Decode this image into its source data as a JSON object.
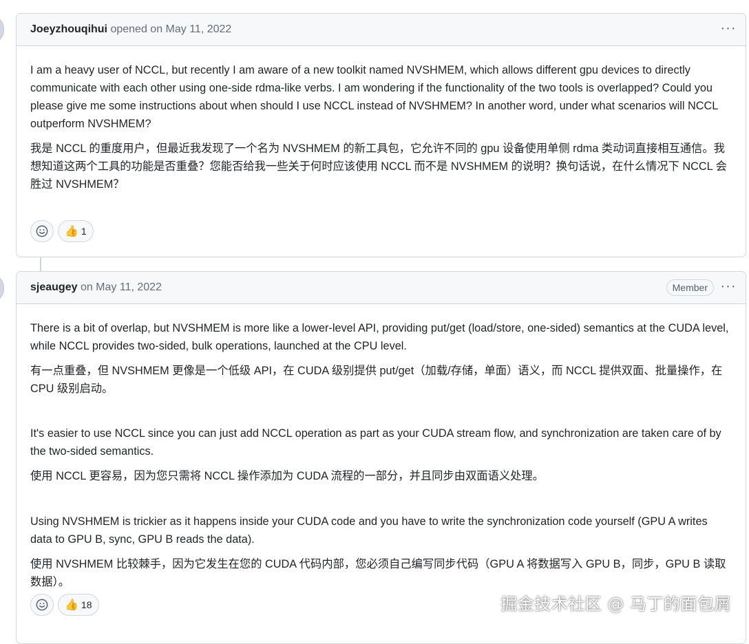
{
  "comments": [
    {
      "author": "Joeyzhouqihui",
      "meta": "opened on May 11, 2022",
      "menu_glyph": "···",
      "paragraphs": [
        "I am a heavy user of NCCL, but recently I am aware of a new toolkit named NVSHMEM, which allows different gpu devices to directly communicate with each other using one-side rdma-like verbs. I am wondering if the functionality of the two tools is overlapped? Could you please give me some instructions about when should I use NCCL instead of NVSHMEM? In another word, under what scenarios will NCCL outperform NVSHMEM?",
        "我是 NCCL 的重度用户，但最近我发现了一个名为 NVSHMEM 的新工具包，它允许不同的 gpu 设备使用单侧 rdma 类动词直接相互通信。我想知道这两个工具的功能是否重叠？您能否给我一些关于何时应该使用 NCCL 而不是 NVSHMEM 的说明？换句话说，在什么情况下 NCCL 会胜过 NVSHMEM？"
      ],
      "thumbs_count": "1"
    },
    {
      "author": "sjeaugey",
      "meta": "on May 11, 2022",
      "badge": "Member",
      "menu_glyph": "···",
      "paragraphs": [
        "There is a bit of overlap, but NVSHMEM is more like a lower-level API, providing put/get (load/store, one-sided) semantics at the CUDA level, while NCCL provides two-sided, bulk operations, launched at the CPU level.",
        "有一点重叠，但 NVSHMEM 更像是一个低级 API，在 CUDA 级别提供 put/get（加载/存储，单面）语义，而 NCCL 提供双面、批量操作，在 CPU 级别启动。",
        "It's easier to use NCCL since you can just add NCCL operation as part as your CUDA stream flow, and synchronization are taken care of by the two-sided semantics.",
        "使用 NCCL 更容易，因为您只需将 NCCL 操作添加为 CUDA 流程的一部分，并且同步由双面语义处理。",
        "Using NVSHMEM is trickier as it happens inside your CUDA code and you have to write the synchronization code yourself (GPU A writes data to GPU B, sync, GPU B reads the data).",
        "使用 NVSHMEM 比较棘手，因为它发生在您的 CUDA 代码内部，您必须自己编写同步代码（GPU A 将数据写入 GPU B，同步，GPU B 读取数据）。"
      ],
      "thumbs_count": "18"
    }
  ],
  "icons": {
    "smiley": "smiley-icon",
    "thumbsup": "thumbsup-icon",
    "kebab": "kebab-horizontal-icon"
  },
  "watermark": "掘金技术社区 @ 马丁的面包屑"
}
